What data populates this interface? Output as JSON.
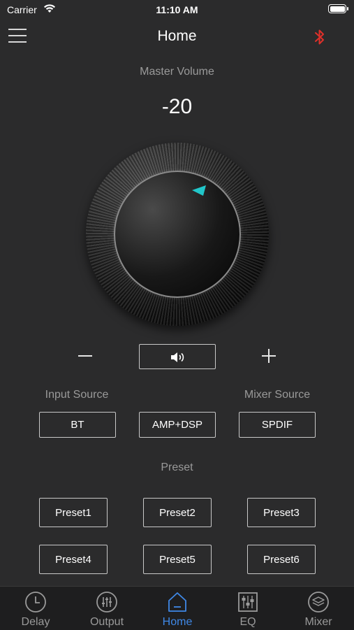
{
  "status_bar": {
    "carrier": "Carrier",
    "time": "11:10 AM"
  },
  "nav": {
    "title": "Home",
    "bluetooth_color": "#e0302a"
  },
  "master_volume": {
    "label": "Master Volume",
    "value": "-20"
  },
  "colors": {
    "accent": "#3f88e6",
    "knob_indicator": "#21c6c9",
    "background": "#2b2b2c"
  },
  "sources": {
    "input_label": "Input Source",
    "mixer_label": "Mixer Source",
    "buttons": [
      "BT",
      "AMP+DSP",
      "SPDIF"
    ]
  },
  "preset": {
    "label": "Preset",
    "buttons": [
      "Preset1",
      "Preset2",
      "Preset3",
      "Preset4",
      "Preset5",
      "Preset6"
    ]
  },
  "tabs": [
    {
      "label": "Delay",
      "icon": "clock-icon",
      "active": false
    },
    {
      "label": "Output",
      "icon": "sliders-icon",
      "active": false
    },
    {
      "label": "Home",
      "icon": "home-icon",
      "active": true
    },
    {
      "label": "EQ",
      "icon": "equalizer-icon",
      "active": false
    },
    {
      "label": "Mixer",
      "icon": "layers-icon",
      "active": false
    }
  ]
}
